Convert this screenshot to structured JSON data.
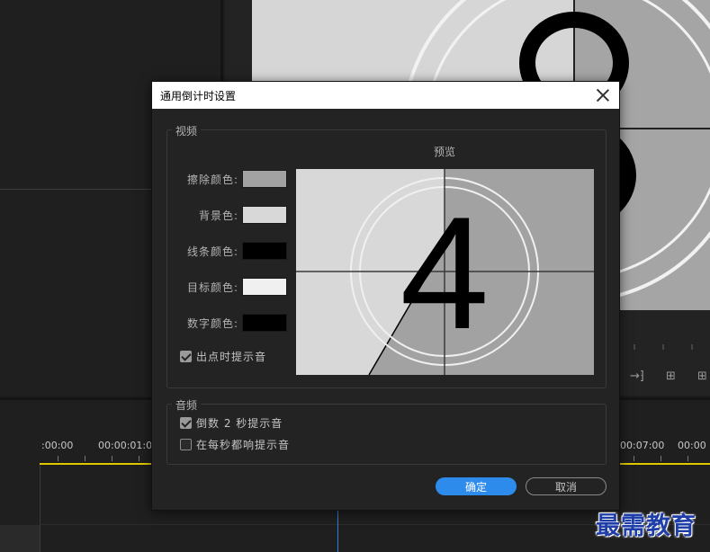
{
  "background": {
    "timecodes": [
      ":00:00",
      "00:00:01:00",
      "00:07:00",
      "00:00"
    ]
  },
  "watermark": "最需教育",
  "dialog": {
    "title": "通用倒计时设置",
    "video": {
      "legend": "视频",
      "preview_label": "预览",
      "countdown_number": "4",
      "colors": [
        {
          "label": "擦除颜色:",
          "hex": "#a2a2a2"
        },
        {
          "label": "背景色:",
          "hex": "#d8d8d8"
        },
        {
          "label": "线条颜色:",
          "hex": "#000000"
        },
        {
          "label": "目标颜色:",
          "hex": "#f0f0f0"
        },
        {
          "label": "数字颜色:",
          "hex": "#000000"
        }
      ],
      "cue_at_out": {
        "label": "出点时提示音",
        "checked": true
      }
    },
    "audio": {
      "legend": "音频",
      "cue_two_sec": {
        "label": "倒数 2 秒提示音",
        "checked": true
      },
      "cue_every_sec": {
        "label": "在每秒都响提示音",
        "checked": false
      }
    },
    "ok_label": "确定",
    "cancel_label": "取消"
  }
}
